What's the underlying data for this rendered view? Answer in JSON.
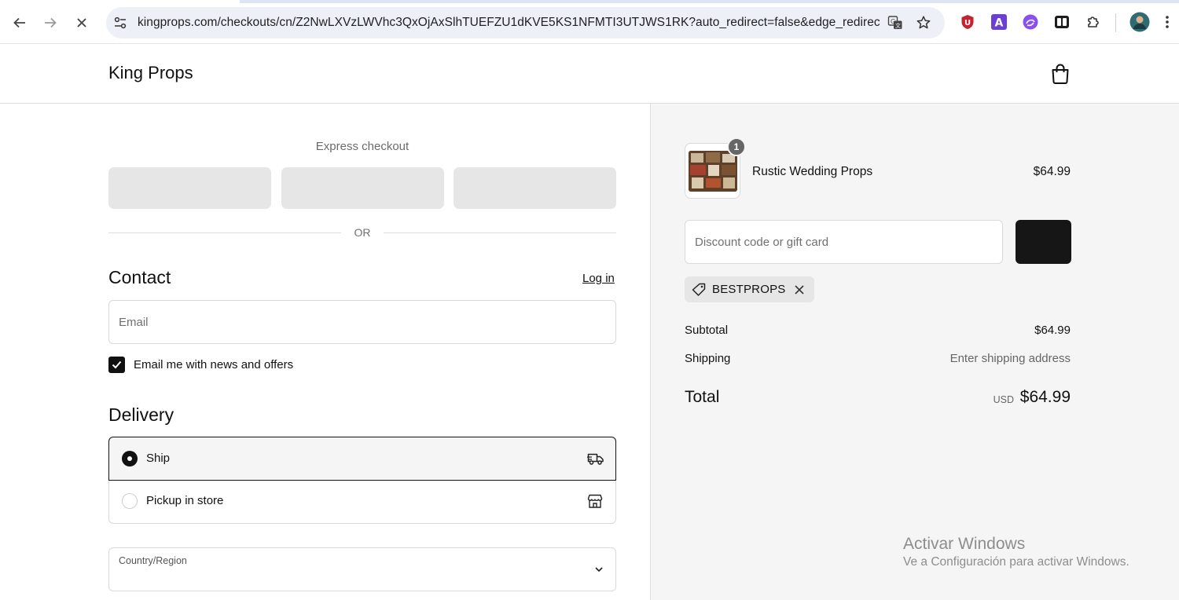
{
  "browser": {
    "url": "kingprops.com/checkouts/cn/Z2NwLXVzLWVhc3QxOjAxSlhTUEFZU1dKVE5KS1NFMTI3UTJWS1RK?auto_redirect=false&edge_redirect=tr...",
    "icons": [
      "back-icon",
      "forward-icon",
      "stop-loading-icon",
      "site-settings-icon",
      "translate-icon",
      "bookmark-star-icon",
      "ublock-icon",
      "extension-a-icon",
      "extension-swirl-icon",
      "extension-split-icon",
      "extensions-puzzle-icon",
      "profile-avatar",
      "more-menu-icon"
    ]
  },
  "header": {
    "brand": "King Props",
    "cart_icon": "shopping-bag-icon"
  },
  "express": {
    "title": "Express checkout",
    "or": "OR"
  },
  "contact": {
    "title": "Contact",
    "login": "Log in",
    "email_placeholder": "Email",
    "newsletter_label": "Email me with news and offers",
    "newsletter_checked": true
  },
  "delivery": {
    "title": "Delivery",
    "options": [
      {
        "label": "Ship",
        "selected": true,
        "icon": "truck-icon"
      },
      {
        "label": "Pickup in store",
        "selected": false,
        "icon": "store-icon"
      }
    ],
    "country_label": "Country/Region"
  },
  "summary": {
    "product": {
      "name": "Rustic Wedding Props",
      "price": "$64.99",
      "quantity": "1"
    },
    "discount_placeholder": "Discount code or gift card",
    "applied_code": "BESTPROPS",
    "subtotal_label": "Subtotal",
    "subtotal_value": "$64.99",
    "shipping_label": "Shipping",
    "shipping_value": "Enter shipping address",
    "total_label": "Total",
    "currency": "USD",
    "total_value": "$64.99"
  },
  "watermark": {
    "line1": "Activar Windows",
    "line2": "Ve a Configuración para activar Windows."
  },
  "colors": {
    "accent": "#111111",
    "summary_bg": "#f5f5f5",
    "placeholder_button": "#e6e6e6"
  }
}
